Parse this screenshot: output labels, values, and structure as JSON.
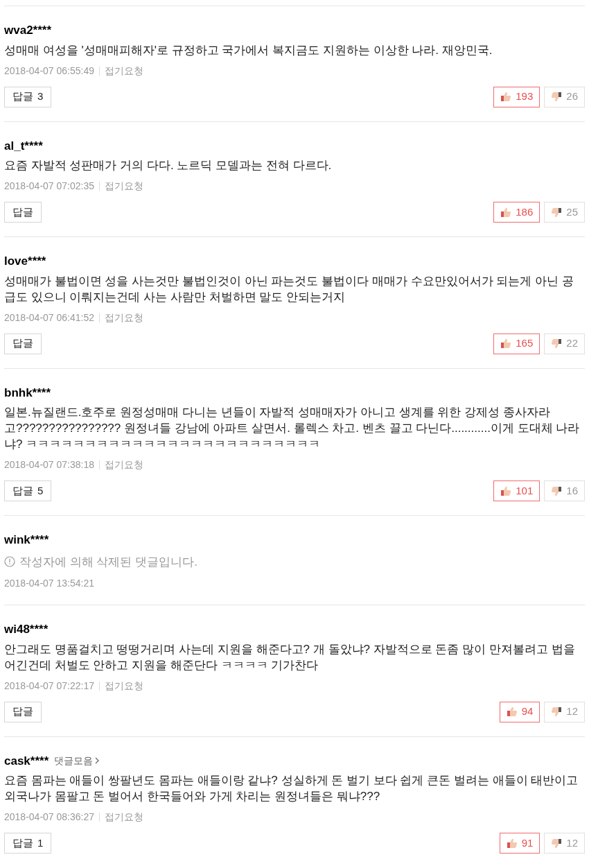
{
  "comments": [
    {
      "kind": "normal",
      "user": "wva2****",
      "text": "성매매 여성을 '성매매피해자'로 규정하고 국가에서 복지금도 지원하는 이상한 나라. 재앙민국.",
      "date": "2018-04-07 06:55:49",
      "report": "접기요청",
      "reply": "답글",
      "reply_count": "3",
      "likes": "193",
      "dislikes": "26"
    },
    {
      "kind": "normal",
      "user": "al_t****",
      "text": "요즘 자발적 성판매가 거의 다다. 노르딕 모델과는 전혀 다르다.",
      "date": "2018-04-07 07:02:35",
      "report": "접기요청",
      "reply": "답글",
      "likes": "186",
      "dislikes": "25"
    },
    {
      "kind": "normal",
      "user": "love****",
      "text": "성매매가 불법이면 성을 사는것만 불법인것이 아닌 파는것도 불법이다 매매가 수요만있어서가 되는게 아닌 공급도 있으니 이뤄지는건데 사는 사람만 처벌하면 말도 안되는거지",
      "date": "2018-04-07 06:41:52",
      "report": "접기요청",
      "reply": "답글",
      "likes": "165",
      "dislikes": "22"
    },
    {
      "kind": "normal",
      "user": "bnhk****",
      "text": "일본.뉴질랜드.호주로 원정성매매 다니는 년들이 자발적 성매매자가 아니고 생계를 위한 강제성 종사자라고???????????????? 원정녀들 강남에 아파트 살면서. 롤렉스 차고. 벤츠 끌고 다닌다............이게 도대체 나라냐? ㅋㅋㅋㅋㅋㅋㅋㅋㅋㅋㅋㅋㅋㅋㅋㅋㅋㅋㅋㅋㅋㅋㅋㅋㅋ",
      "date": "2018-04-07 07:38:18",
      "report": "접기요청",
      "reply": "답글",
      "reply_count": "5",
      "likes": "101",
      "dislikes": "16"
    },
    {
      "kind": "deleted",
      "user": "wink****",
      "text": "작성자에 의해 삭제된 댓글입니다.",
      "date": "2018-04-07 13:54:21"
    },
    {
      "kind": "normal",
      "user": "wi48****",
      "text": "안그래도 명품걸치고 떵떵거리며 사는데 지원을 해준다고? 개 돌았냐? 자발적으로 돈좀 많이 만져볼려고 법을 어긴건데 처벌도 안하고 지원을 해준단다 ㅋㅋㅋㅋ 기가찬다",
      "date": "2018-04-07 07:22:17",
      "report": "접기요청",
      "reply": "답글",
      "likes": "94",
      "dislikes": "12"
    },
    {
      "kind": "normal",
      "user": "cask****",
      "user_link": "댓글모음",
      "text": "요즘 몸파는 애들이 쌍팔년도 몸파는 애들이랑 같냐? 성실하게 돈 벌기 보다 쉽게 큰돈 벌려는 애들이 태반이고 외국나가 몸팔고 돈 벌어서 한국들어와 가게 차리는 원정녀들은 뭐냐???",
      "date": "2018-04-07 08:36:27",
      "report": "접기요청",
      "reply": "답글",
      "reply_count": "1",
      "likes": "91",
      "dislikes": "12"
    }
  ]
}
